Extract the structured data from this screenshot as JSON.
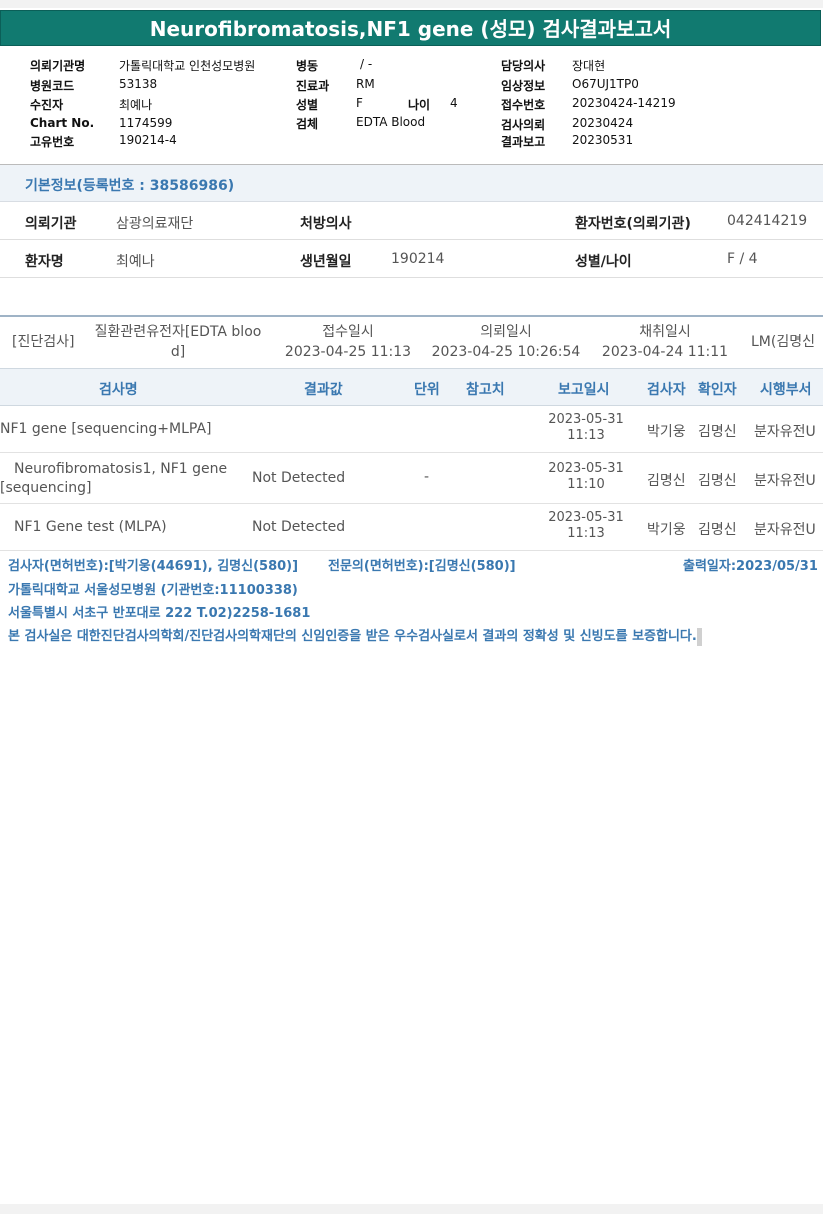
{
  "report": {
    "title": "Neurofibromatosis,NF1 gene (성모) 검사결과보고서"
  },
  "header": {
    "col1": [
      {
        "label": "의뢰기관명",
        "value": "가톨릭대학교 인천성모병원"
      },
      {
        "label": "병원코드",
        "value": "53138"
      },
      {
        "label": "수진자",
        "value": "최예나"
      },
      {
        "label": "Chart No.",
        "value": "1174599"
      },
      {
        "label": "고유번호",
        "value": "190214-4"
      }
    ],
    "col2": [
      {
        "label": "병동",
        "value": "/ -"
      },
      {
        "label": "진료과",
        "value": "RM"
      },
      {
        "label": "성별",
        "value": "F"
      },
      {
        "label": "검체",
        "value": "EDTA Blood"
      }
    ],
    "age": {
      "label": "나이",
      "value": "4"
    },
    "col3": [
      {
        "label": "담당의사",
        "value": "장대현"
      },
      {
        "label": "임상정보",
        "value": "O67UJ1TP0"
      },
      {
        "label": "접수번호",
        "value": "20230424-14219"
      },
      {
        "label": "검사의뢰",
        "value": "20230424"
      },
      {
        "label": "결과보고",
        "value": "20230531"
      }
    ]
  },
  "basic": {
    "heading": "기본정보(등록번호 : 38586986)",
    "row1": [
      {
        "label": "의뢰기관",
        "value": "삼광의료재단"
      },
      {
        "label": "처방의사",
        "value": ""
      },
      {
        "label": "환자번호(의뢰기관)",
        "value": "042414219"
      }
    ],
    "row2": [
      {
        "label": "환자명",
        "value": "최예나"
      },
      {
        "label": "생년월일",
        "value": "190214"
      },
      {
        "label": "성별/나이",
        "value": "F / 4"
      }
    ]
  },
  "order": {
    "category": "[진단검사]",
    "name_line1": "질환관련유전자[EDTA bloo",
    "name_line2": "d]",
    "received_label": "접수일시",
    "received_value": "2023-04-25 11:13",
    "requested_label": "의뢰일시",
    "requested_value": "2023-04-25 10:26:54",
    "collected_label": "채취일시",
    "collected_value": "2023-04-24 11:11",
    "lab": "LM(김명신"
  },
  "table": {
    "headers": [
      "검사명",
      "결과값",
      "단위",
      "참고치",
      "보고일시",
      "검사자",
      "확인자",
      "시행부서"
    ],
    "rows": [
      {
        "name_line1": "NF1 gene [sequencing+MLPA]",
        "name_line2": "",
        "result": "",
        "unit": "",
        "ref": "",
        "date": "2023-05-31",
        "time": "11:13",
        "tester": "박기웅",
        "confirmer": "김명신",
        "dept": "분자유전U"
      },
      {
        "name_line1": "Neurofibromatosis1, NF1 gene",
        "name_line2": "[sequencing]",
        "result": "Not Detected",
        "unit": "",
        "ref": "-",
        "date": "2023-05-31",
        "time": "11:10",
        "tester": "김명신",
        "confirmer": "김명신",
        "dept": "분자유전U"
      },
      {
        "name_line1": "NF1 Gene test (MLPA)",
        "name_line2": "",
        "result": "Not Detected",
        "unit": "",
        "ref": "",
        "date": "2023-05-31",
        "time": "11:13",
        "tester": "박기웅",
        "confirmer": "김명신",
        "dept": "분자유전U"
      }
    ]
  },
  "footer": {
    "testers": "검사자(면허번호):[박기웅(44691), 김명신(580)]",
    "specialist": "전문의(면허번호):[김명신(580)]",
    "print_date": "출력일자:2023/05/31",
    "hospital": "가톨릭대학교 서울성모병원 (기관번호:11100338)",
    "address": "서울특별시 서초구 반포대로 222 T.02)2258-1681",
    "certification": "본 검사실은 대한진단검사의학회/진단검사의학재단의 신임인증을 받은 우수검사실로서 결과의 정확성 및 신빙도를 보증합니다."
  }
}
